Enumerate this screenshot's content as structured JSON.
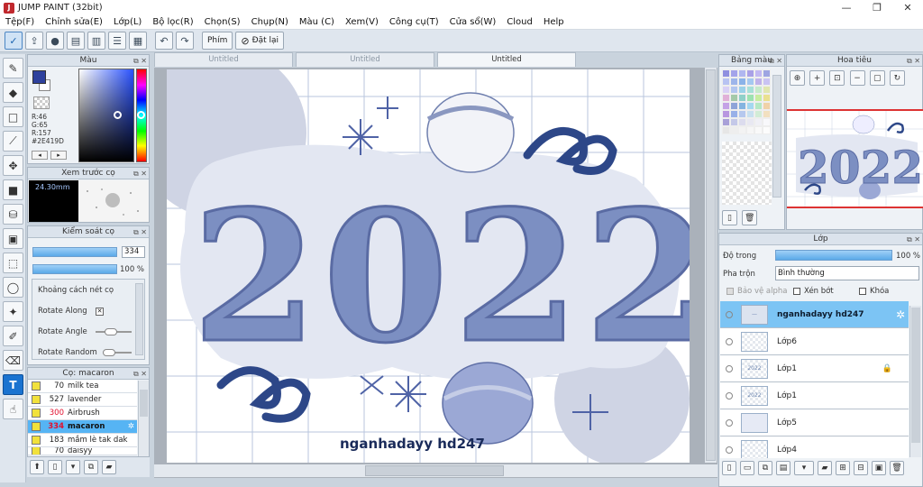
{
  "app": {
    "title": "JUMP PAINT (32bit)",
    "icon_text": "J"
  },
  "window_buttons": [
    "—",
    "❐",
    "✕"
  ],
  "menu": [
    "Tệp(F)",
    "Chỉnh sửa(E)",
    "Lớp(L)",
    "Bộ lọc(R)",
    "Chọn(S)",
    "Chụp(N)",
    "Màu (C)",
    "Xem(V)",
    "Công cụ(T)",
    "Cửa sổ(W)",
    "Cloud",
    "Help"
  ],
  "toolbar": {
    "phim_label": "Phím",
    "reset_label": "Đặt lại"
  },
  "tabs": [
    "Untitled",
    "Untitled",
    "Untitled"
  ],
  "color_panel": {
    "title": "Màu",
    "r": "R:46",
    "g": "G:65",
    "b": "R:157",
    "hex": "#2E419D",
    "main_color": "#2E419D"
  },
  "brush_preview": {
    "title": "Xem trước cọ",
    "size": "24.30mm"
  },
  "brush_control": {
    "title": "Kiểm soát cọ",
    "size_value": "334",
    "opacity_value": "100 %",
    "options": [
      "Khoảng cách nét cọ",
      "Rotate Along",
      "Rotate Angle",
      "Rotate Random"
    ]
  },
  "brush_list": {
    "title": "Cọ: macaron",
    "items": [
      {
        "num": "70",
        "name": "milk tea"
      },
      {
        "num": "527",
        "name": "lavender"
      },
      {
        "num": "300",
        "name": "Airbrush"
      },
      {
        "num": "334",
        "name": "macaron"
      },
      {
        "num": "183",
        "name": "mầm lè tak dak"
      },
      {
        "num": "70",
        "name": "daisyy"
      }
    ],
    "selected_index": 3
  },
  "palette": {
    "title": "Bảng màu"
  },
  "navigator": {
    "title": "Hoa tiêu"
  },
  "artwork": {
    "big_text": "2022",
    "signature": "nganhadayy hd247"
  },
  "layer_panel": {
    "title": "Lớp",
    "opacity_label": "Độ trong",
    "opacity_value": "100 %",
    "blend_label": "Pha trộn",
    "blend_value": "Bình thường",
    "opt_alpha": "Bảo vệ alpha",
    "opt_clip": "Xén bớt",
    "opt_lock": "Khóa",
    "layers": [
      "nganhadayy hd247",
      "Lớp6",
      "Lớp1",
      "Lớp1",
      "Lớp5",
      "Lớp4"
    ],
    "selected_index": 0
  }
}
